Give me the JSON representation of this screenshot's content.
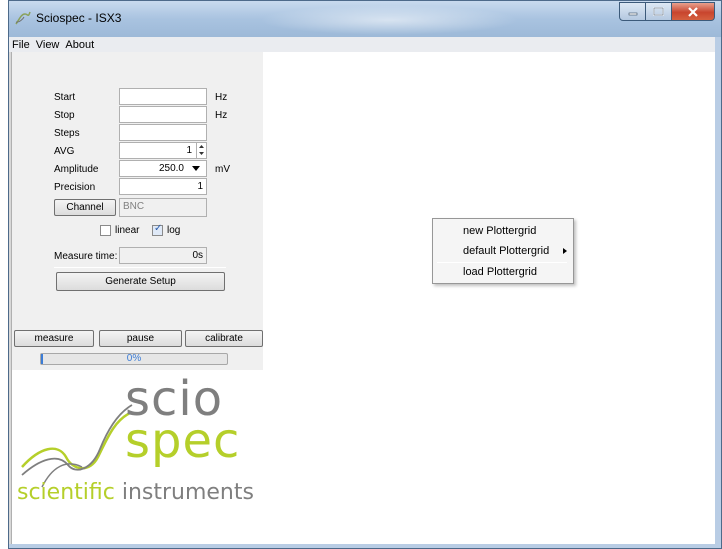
{
  "window": {
    "title": "Sciospec - ISX3",
    "controls": [
      "minimize-icon",
      "maximize-icon",
      "close-icon"
    ]
  },
  "menubar": {
    "items": [
      "File",
      "View",
      "About"
    ]
  },
  "settings": {
    "start": {
      "label": "Start",
      "value": "",
      "unit": "Hz"
    },
    "stop": {
      "label": "Stop",
      "value": "",
      "unit": "Hz"
    },
    "steps": {
      "label": "Steps",
      "value": ""
    },
    "avg": {
      "label": "AVG",
      "value": "1"
    },
    "amplitude": {
      "label": "Amplitude",
      "value": "250.0",
      "unit": "mV"
    },
    "precision": {
      "label": "Precision",
      "value": "1"
    },
    "channel": {
      "button": "Channel",
      "value": "BNC"
    },
    "scale": {
      "linear": "linear",
      "linear_checked": false,
      "log": "log",
      "log_checked": true
    },
    "measure_time": {
      "label": "Measure time:",
      "value": "0s"
    },
    "generate_button": "Generate Setup"
  },
  "actions": {
    "measure": "measure",
    "pause": "pause",
    "calibrate": "calibrate"
  },
  "progress": {
    "value": 0,
    "text": "0%"
  },
  "logo": {
    "line1": "scio",
    "line2": "spec",
    "tagline_1": "scientific",
    "tagline_2": " instruments",
    "colors": {
      "gray": "#7f7f7f",
      "green": "#b5cf2a"
    }
  },
  "context_menu": {
    "items": [
      "new Plottergrid",
      "default Plottergrid",
      "load Plottergrid"
    ]
  }
}
